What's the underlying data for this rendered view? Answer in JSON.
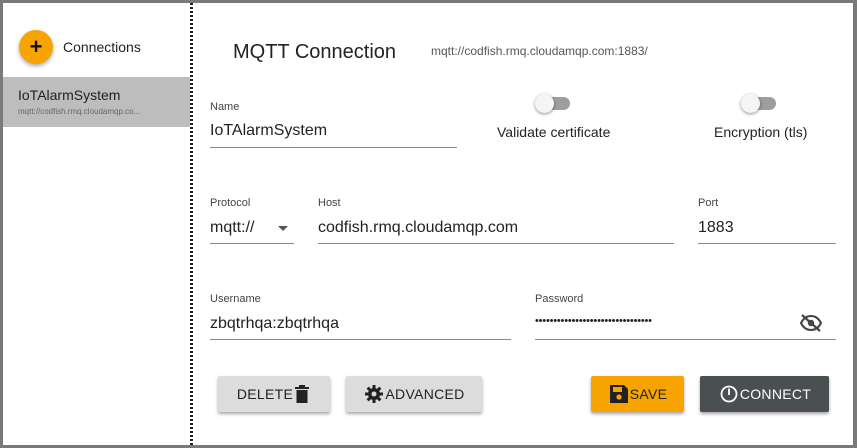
{
  "sidebar": {
    "add_icon": "plus-icon",
    "connections_label": "Connections",
    "items": [
      {
        "name": "IoTAlarmSystem",
        "url": "mqtt://codfish.rmq.cloudamqp.co..."
      }
    ]
  },
  "header": {
    "title": "MQTT Connection",
    "url": "mqtt://codfish.rmq.cloudamqp.com:1883/"
  },
  "form": {
    "name_label": "Name",
    "name_value": "IoTAlarmSystem",
    "validate_label": "Validate certificate",
    "validate_on": false,
    "encryption_label": "Encryption (tls)",
    "encryption_on": false,
    "protocol_label": "Protocol",
    "protocol_value": "mqtt://",
    "host_label": "Host",
    "host_value": "codfish.rmq.cloudamqp.com",
    "port_label": "Port",
    "port_value": "1883",
    "username_label": "Username",
    "username_value": "zbqtrhqa:zbqtrhqa",
    "password_label": "Password",
    "password_value": "••••••••••••••••••••••••••••••••",
    "password_visibility_icon": "eye-off-icon"
  },
  "actions": {
    "delete_label": "DELETE",
    "delete_icon": "trash-icon",
    "advanced_label": "ADVANCED",
    "advanced_icon": "gear-icon",
    "save_label": "SAVE",
    "save_icon": "floppy-disk-icon",
    "connect_label": "CONNECT",
    "connect_icon": "power-icon"
  },
  "colors": {
    "accent": "#f7a400",
    "connect": "#4a4f52",
    "selected_item": "#bdbdbd"
  }
}
